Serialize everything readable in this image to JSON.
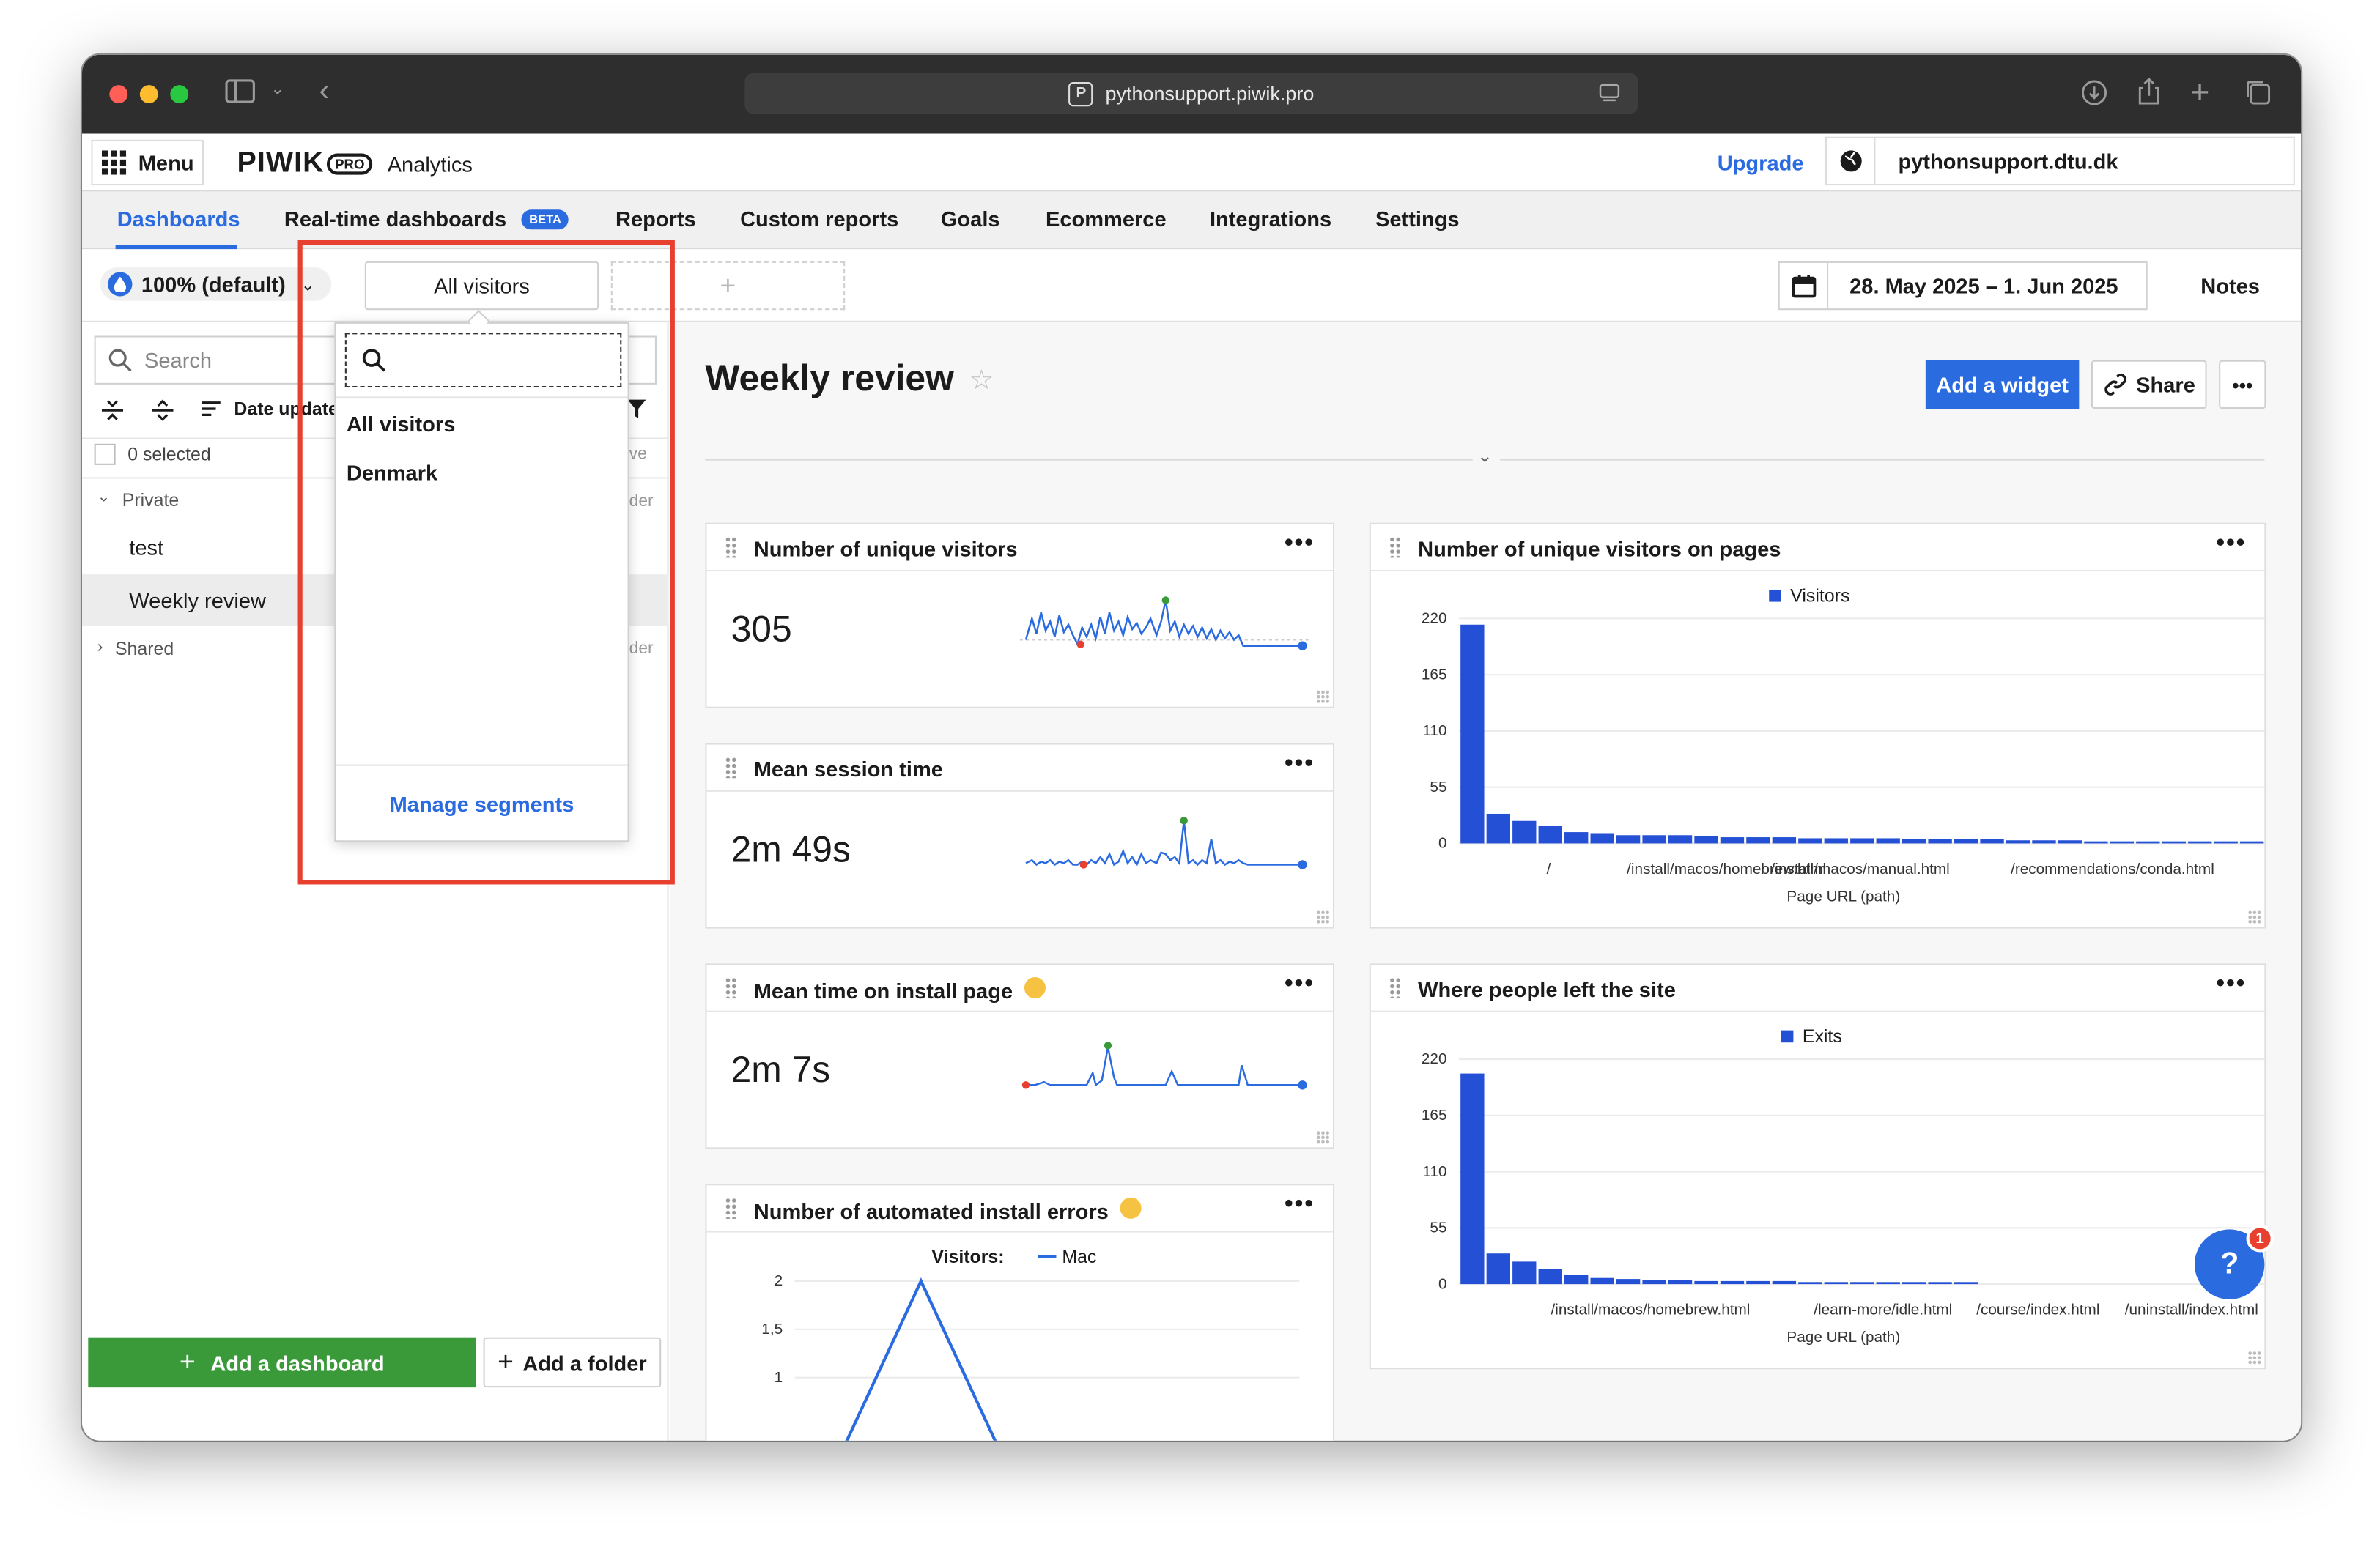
{
  "browser": {
    "url": "pythonsupport.piwik.pro"
  },
  "topbar": {
    "menu_label": "Menu",
    "logo_text": "PIWIK",
    "logo_badge": "PRO",
    "product": "Analytics",
    "upgrade": "Upgrade",
    "site": "pythonsupport.dtu.dk"
  },
  "nav": {
    "tabs": [
      {
        "label": "Dashboards",
        "active": true
      },
      {
        "label": "Real-time dashboards",
        "badge": "BETA"
      },
      {
        "label": "Reports"
      },
      {
        "label": "Custom reports"
      },
      {
        "label": "Goals"
      },
      {
        "label": "Ecommerce"
      },
      {
        "label": "Integrations"
      },
      {
        "label": "Settings"
      }
    ]
  },
  "filters": {
    "sampling": "100% (default)",
    "segment": "All visitors",
    "add_segment": "+",
    "date_range": "28. May 2025 – 1. Jun 2025",
    "notes": "Notes"
  },
  "sidebar": {
    "search_placeholder": "Search",
    "sort_label": "Date updated",
    "selected": "0 selected",
    "remove_partial": "ve",
    "private_label": "Private",
    "folder_partial": "der",
    "items": [
      "test",
      "Weekly review"
    ],
    "shared_label": "Shared",
    "add_dashboard": "Add a dashboard",
    "add_folder": "Add a folder"
  },
  "segment_dropdown": {
    "options": [
      "All visitors",
      "Denmark"
    ],
    "manage": "Manage segments"
  },
  "dashboard": {
    "title": "Weekly review",
    "add_widget": "Add a widget",
    "share": "Share",
    "more": "•••"
  },
  "widgets": {
    "unique_visitors": {
      "title": "Number of unique visitors",
      "value": "305"
    },
    "session_time": {
      "title": "Mean session time",
      "value": "2m 49s"
    },
    "install_time": {
      "title": "Mean time on install page",
      "value": "2m 7s"
    },
    "install_errors": {
      "title": "Number of automated install errors",
      "legend_prefix": "Visitors:",
      "legend": "Mac"
    },
    "visitors_pages": {
      "title": "Number of unique visitors on pages",
      "legend": "Visitors",
      "xlabel": "Page URL (path)",
      "tick_labels": [
        "/",
        "/install/macos/homebrew.html",
        "/install/macos/manual.html",
        "/recommendations/conda.html"
      ]
    },
    "exits": {
      "title": "Where people left the site",
      "legend": "Exits",
      "xlabel": "Page URL (path)",
      "tick_labels": [
        "/install/macos/homebrew.html",
        "/learn-more/idle.html",
        "/course/index.html",
        "/uninstall/index.html"
      ]
    }
  },
  "help": {
    "label": "?",
    "count": "1"
  },
  "colors": {
    "accent": "#2b6be0",
    "bar": "#2450d6",
    "green": "#3a9a3a",
    "red": "#e8402e"
  },
  "chart_data": [
    {
      "type": "bar",
      "title": "Number of unique visitors on pages",
      "xlabel": "Page URL (path)",
      "ylabel": "",
      "ylim": [
        0,
        220
      ],
      "yticks": [
        0,
        55,
        110,
        165,
        220
      ],
      "series": [
        {
          "name": "Visitors",
          "values": [
            214,
            29,
            22,
            17,
            11,
            10,
            8,
            8,
            8,
            7,
            6,
            6,
            6,
            5,
            5,
            5,
            5,
            4,
            4,
            4,
            4,
            3,
            3,
            3,
            2,
            2,
            2,
            2,
            2,
            2,
            2
          ]
        }
      ]
    },
    {
      "type": "bar",
      "title": "Where people left the site",
      "xlabel": "Page URL (path)",
      "ylabel": "",
      "ylim": [
        0,
        220
      ],
      "yticks": [
        0,
        55,
        110,
        165,
        220
      ],
      "series": [
        {
          "name": "Exits",
          "values": [
            206,
            30,
            22,
            15,
            9,
            6,
            5,
            4,
            4,
            3,
            3,
            3,
            3,
            2,
            2,
            2,
            2,
            2,
            2,
            2
          ]
        }
      ]
    },
    {
      "type": "line",
      "title": "Number of automated install errors",
      "ylim": [
        0,
        2
      ],
      "yticks": [
        "1",
        "1,5",
        "2"
      ],
      "series": [
        {
          "name": "Mac",
          "x": [
            0,
            1,
            2
          ],
          "values": [
            0,
            2,
            0
          ]
        }
      ]
    }
  ]
}
